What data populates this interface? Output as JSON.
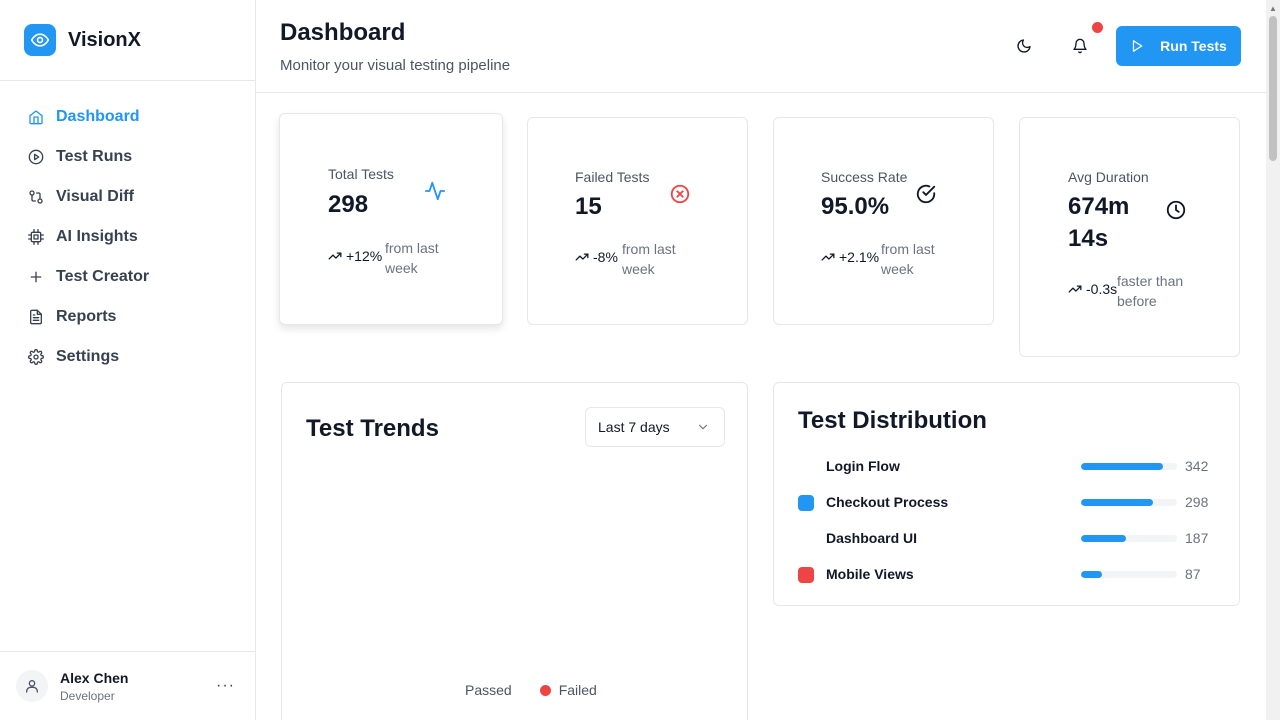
{
  "app": {
    "name": "VisionX",
    "logo_icon": "eye-icon",
    "accent": "#2196f3",
    "danger": "#ef4444"
  },
  "sidebar": {
    "items": [
      {
        "label": "Dashboard",
        "icon": "home-icon",
        "active": true
      },
      {
        "label": "Test Runs",
        "icon": "play-circle-icon"
      },
      {
        "label": "Visual Diff",
        "icon": "git-compare-icon"
      },
      {
        "label": "AI Insights",
        "icon": "cpu-icon"
      },
      {
        "label": "Test Creator",
        "icon": "plus-icon"
      },
      {
        "label": "Reports",
        "icon": "file-text-icon"
      },
      {
        "label": "Settings",
        "icon": "gear-icon"
      }
    ],
    "user": {
      "name": "Alex Chen",
      "role": "Developer",
      "more": "···"
    }
  },
  "header": {
    "title": "Dashboard",
    "subtitle": "Monitor your visual testing pipeline",
    "run_label": "Run Tests",
    "notifications_unread": true
  },
  "stats": [
    {
      "label": "Total Tests",
      "value": "298",
      "change": "+12%",
      "note": "from last week",
      "icon": "activity-icon",
      "icon_color": "#2196f3"
    },
    {
      "label": "Failed Tests",
      "value": "15",
      "change": "-8%",
      "note": "from last week",
      "icon": "x-circle-icon",
      "icon_color": "#ef4444"
    },
    {
      "label": "Success Rate",
      "value": "95.0%",
      "change": "+2.1%",
      "note": "from last week",
      "icon": "check-circle-icon",
      "icon_color": "#111827"
    },
    {
      "label": "Avg Duration",
      "value": "674m 14s",
      "change": "-0.3s",
      "note": "faster than before",
      "icon": "clock-icon",
      "icon_color": "#111827"
    }
  ],
  "trends": {
    "title": "Test Trends",
    "range": "Last 7 days",
    "legend": [
      {
        "label": "Passed",
        "color": ""
      },
      {
        "label": "Failed",
        "color": "#ef4444"
      }
    ]
  },
  "distribution": {
    "title": "Test Distribution",
    "max": 400,
    "items": [
      {
        "name": "Login Flow",
        "value": "342",
        "swatch": ""
      },
      {
        "name": "Checkout Process",
        "value": "298",
        "swatch": "#2196f3"
      },
      {
        "name": "Dashboard UI",
        "value": "187",
        "swatch": ""
      },
      {
        "name": "Mobile Views",
        "value": "87",
        "swatch": "#ef4444"
      }
    ]
  }
}
